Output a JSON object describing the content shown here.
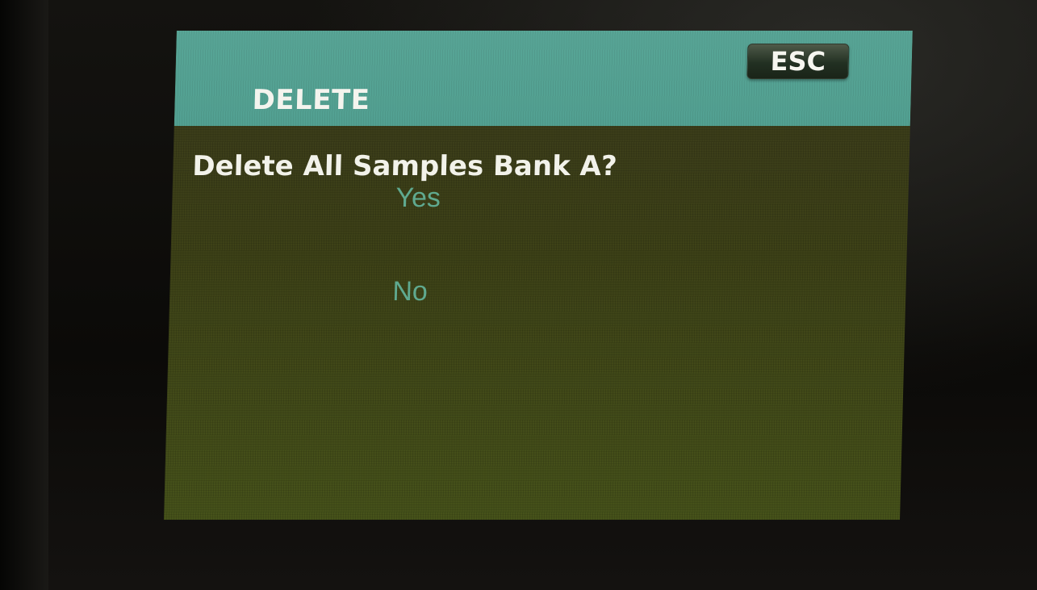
{
  "screen": {
    "header": {
      "title": "DELETE",
      "esc_label": "ESC"
    },
    "dialog": {
      "question": "Delete All Samples Bank A?",
      "options": [
        {
          "label": "Yes"
        },
        {
          "label": "No"
        }
      ]
    }
  },
  "colors": {
    "header_bg": "#55a394",
    "screen_bg": "#3e4418",
    "option_text": "#5fa98f",
    "primary_text": "#f2f2ea"
  }
}
